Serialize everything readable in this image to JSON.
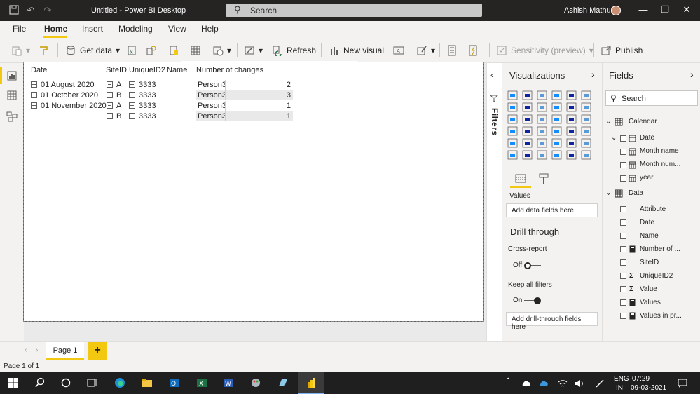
{
  "window": {
    "title": "Untitled - Power BI Desktop",
    "search_label": "Search",
    "user": "Ashish Mathur"
  },
  "menu": [
    {
      "label": "File"
    },
    {
      "label": "Home"
    },
    {
      "label": "Insert"
    },
    {
      "label": "Modeling"
    },
    {
      "label": "View"
    },
    {
      "label": "Help"
    }
  ],
  "ribbon": {
    "get_data": "Get data",
    "refresh": "Refresh",
    "new_visual": "New visual",
    "sensitivity": "Sensitivity (preview)",
    "publish": "Publish"
  },
  "matrix": {
    "headers": [
      "Date",
      "SiteID",
      "UniqueID2",
      "Name",
      "Number of changes"
    ],
    "rows": [
      {
        "date": "01 August 2020",
        "site": "A",
        "uid": "3333",
        "name": "Person3",
        "value": "2"
      },
      {
        "date": "01 October 2020",
        "site": "B",
        "uid": "3333",
        "name": "Person3",
        "value": "3"
      },
      {
        "date": "01 November 2020",
        "site": "A",
        "uid": "3333",
        "name": "Person3",
        "value": "1"
      },
      {
        "date": "",
        "site": "B",
        "uid": "3333",
        "name": "Person3",
        "value": "1"
      }
    ]
  },
  "filters_label": "Filters",
  "visualizations": {
    "title": "Visualizations",
    "values_label": "Values",
    "add_data": "Add data fields here",
    "drill_title": "Drill through",
    "cross_report": "Cross-report",
    "cross_state": "Off",
    "keep_filters": "Keep all filters",
    "keep_state": "On",
    "add_drill": "Add drill-through fields here"
  },
  "fields": {
    "title": "Fields",
    "search_placeholder": "Search",
    "calendar": "Calendar",
    "calendar_items": [
      "Date",
      "Month name",
      "Month num...",
      "year"
    ],
    "data": "Data",
    "data_items": [
      "Attribute",
      "Date",
      "Name",
      "Number of ...",
      "SiteID",
      "UniqueID2",
      "Value",
      "Values",
      "Values in pr..."
    ]
  },
  "pages": {
    "page1": "Page 1",
    "status": "Page 1 of 1"
  },
  "tray": {
    "lang1": "ENG",
    "lang2": "IN",
    "time": "07:29",
    "date": "09-03-2021"
  },
  "colors": {
    "accent": "#f2c811",
    "titlebar": "#252423",
    "pane": "#f3f2f1"
  }
}
